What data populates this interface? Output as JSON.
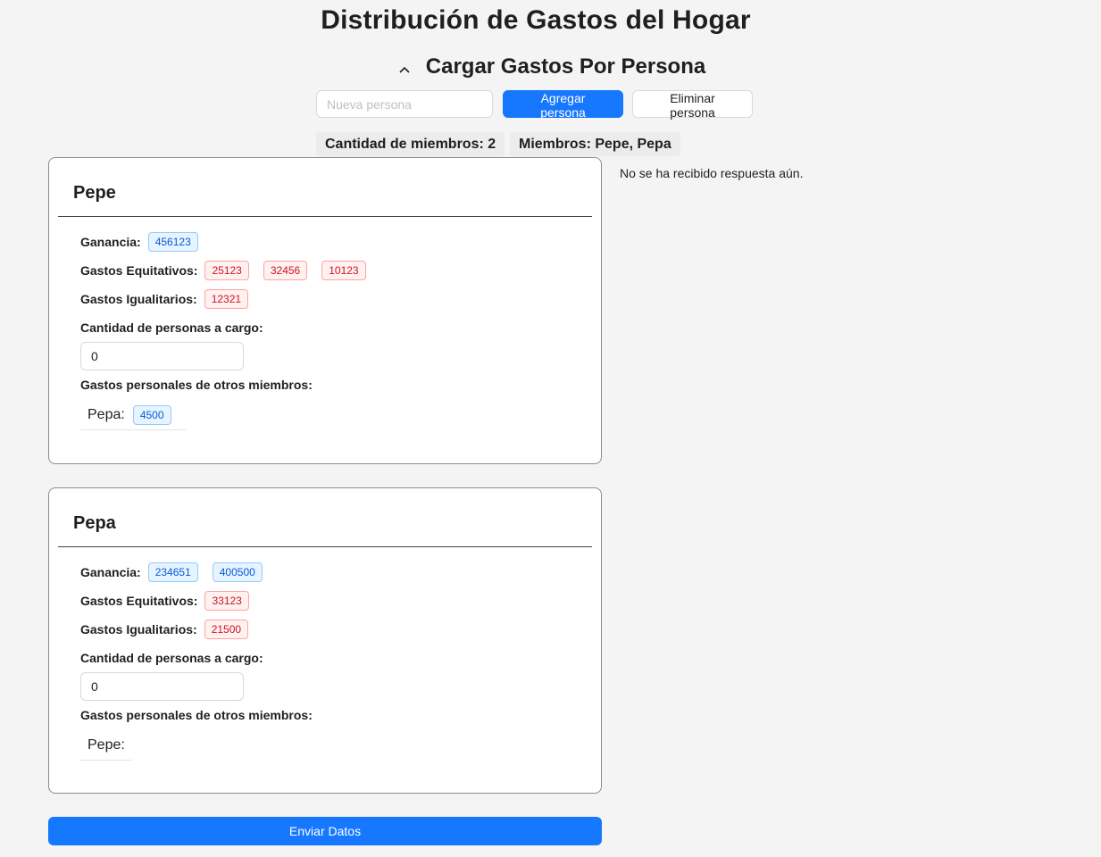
{
  "page": {
    "title": "Distribución de Gastos del Hogar"
  },
  "section": {
    "title": "Cargar Gastos Por Persona",
    "toggle_icon": "chevron-up-icon"
  },
  "toolbar": {
    "new_person_placeholder": "Nueva persona",
    "new_person_value": "",
    "add_label": "Agregar persona",
    "remove_label": "Eliminar persona"
  },
  "summary": {
    "member_count": "Cantidad de miembros: 2",
    "members": "Miembros: Pepe, Pepa"
  },
  "response": {
    "text": "No se ha recibido respuesta aún."
  },
  "labels": {
    "income": "Ganancia:",
    "equitable": "Gastos Equitativos:",
    "egalitarian": "Gastos Igualitarios:",
    "dependents": "Cantidad de personas a cargo:",
    "other_personal": "Gastos personales de otros miembros:"
  },
  "persons": [
    {
      "name": "Pepe",
      "income": [
        "456123"
      ],
      "equitable": [
        "25123",
        "32456",
        "10123"
      ],
      "egalitarian": [
        "12321"
      ],
      "dependents": "0",
      "other_expenses": [
        {
          "name": "Pepa:",
          "values": [
            "4500"
          ]
        }
      ]
    },
    {
      "name": "Pepa",
      "income": [
        "234651",
        "400500"
      ],
      "equitable": [
        "33123"
      ],
      "egalitarian": [
        "21500"
      ],
      "dependents": "0",
      "other_expenses": [
        {
          "name": "Pepe:",
          "values": []
        }
      ]
    }
  ],
  "submit": {
    "label": "Enviar Datos"
  },
  "colors": {
    "primary": "#1677ff",
    "income_tag": "#0958d9",
    "expense_tag": "#cf1322",
    "background": "#f4f4f4"
  }
}
